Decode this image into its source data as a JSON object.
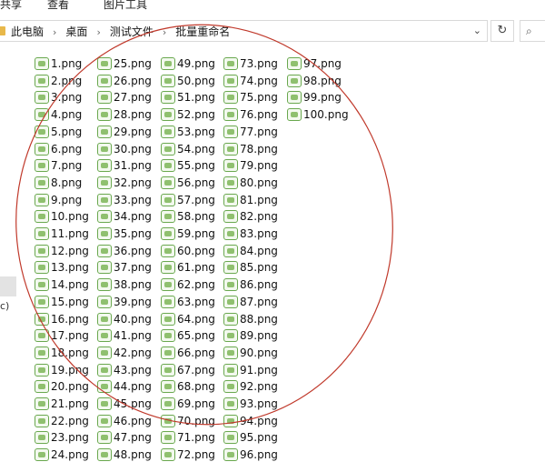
{
  "ribbon": {
    "tabs": [
      "共享",
      "查看",
      "图片工具"
    ]
  },
  "address": {
    "crumbs": [
      "此电脑",
      "桌面",
      "测试文件",
      "批量重命名"
    ],
    "dropdown_glyph": "⌄",
    "refresh_glyph": "↻",
    "search_glyph": "⌕"
  },
  "nav": {
    "partial_text": "c)"
  },
  "files": [
    "1.png",
    "2.png",
    "3.png",
    "4.png",
    "5.png",
    "6.png",
    "7.png",
    "8.png",
    "9.png",
    "10.png",
    "11.png",
    "12.png",
    "13.png",
    "14.png",
    "15.png",
    "16.png",
    "17.png",
    "18.png",
    "19.png",
    "20.png",
    "21.png",
    "22.png",
    "23.png",
    "24.png",
    "25.png",
    "26.png",
    "27.png",
    "28.png",
    "29.png",
    "30.png",
    "31.png",
    "32.png",
    "33.png",
    "34.png",
    "35.png",
    "36.png",
    "37.png",
    "38.png",
    "39.png",
    "40.png",
    "41.png",
    "42.png",
    "43.png",
    "44.png",
    "45.png",
    "46.png",
    "47.png",
    "48.png",
    "49.png",
    "50.png",
    "51.png",
    "52.png",
    "53.png",
    "54.png",
    "55.png",
    "56.png",
    "57.png",
    "58.png",
    "59.png",
    "60.png",
    "61.png",
    "62.png",
    "63.png",
    "64.png",
    "65.png",
    "66.png",
    "67.png",
    "68.png",
    "69.png",
    "70.png",
    "71.png",
    "72.png",
    "73.png",
    "74.png",
    "75.png",
    "76.png",
    "77.png",
    "78.png",
    "79.png",
    "80.png",
    "81.png",
    "82.png",
    "83.png",
    "84.png",
    "85.png",
    "86.png",
    "87.png",
    "88.png",
    "89.png",
    "90.png",
    "91.png",
    "92.png",
    "93.png",
    "94.png",
    "95.png",
    "96.png",
    "97.png",
    "98.png",
    "99.png",
    "100.png"
  ],
  "colors": {
    "annotation_circle": "#c0392b",
    "file_icon": "#6aa84f"
  }
}
